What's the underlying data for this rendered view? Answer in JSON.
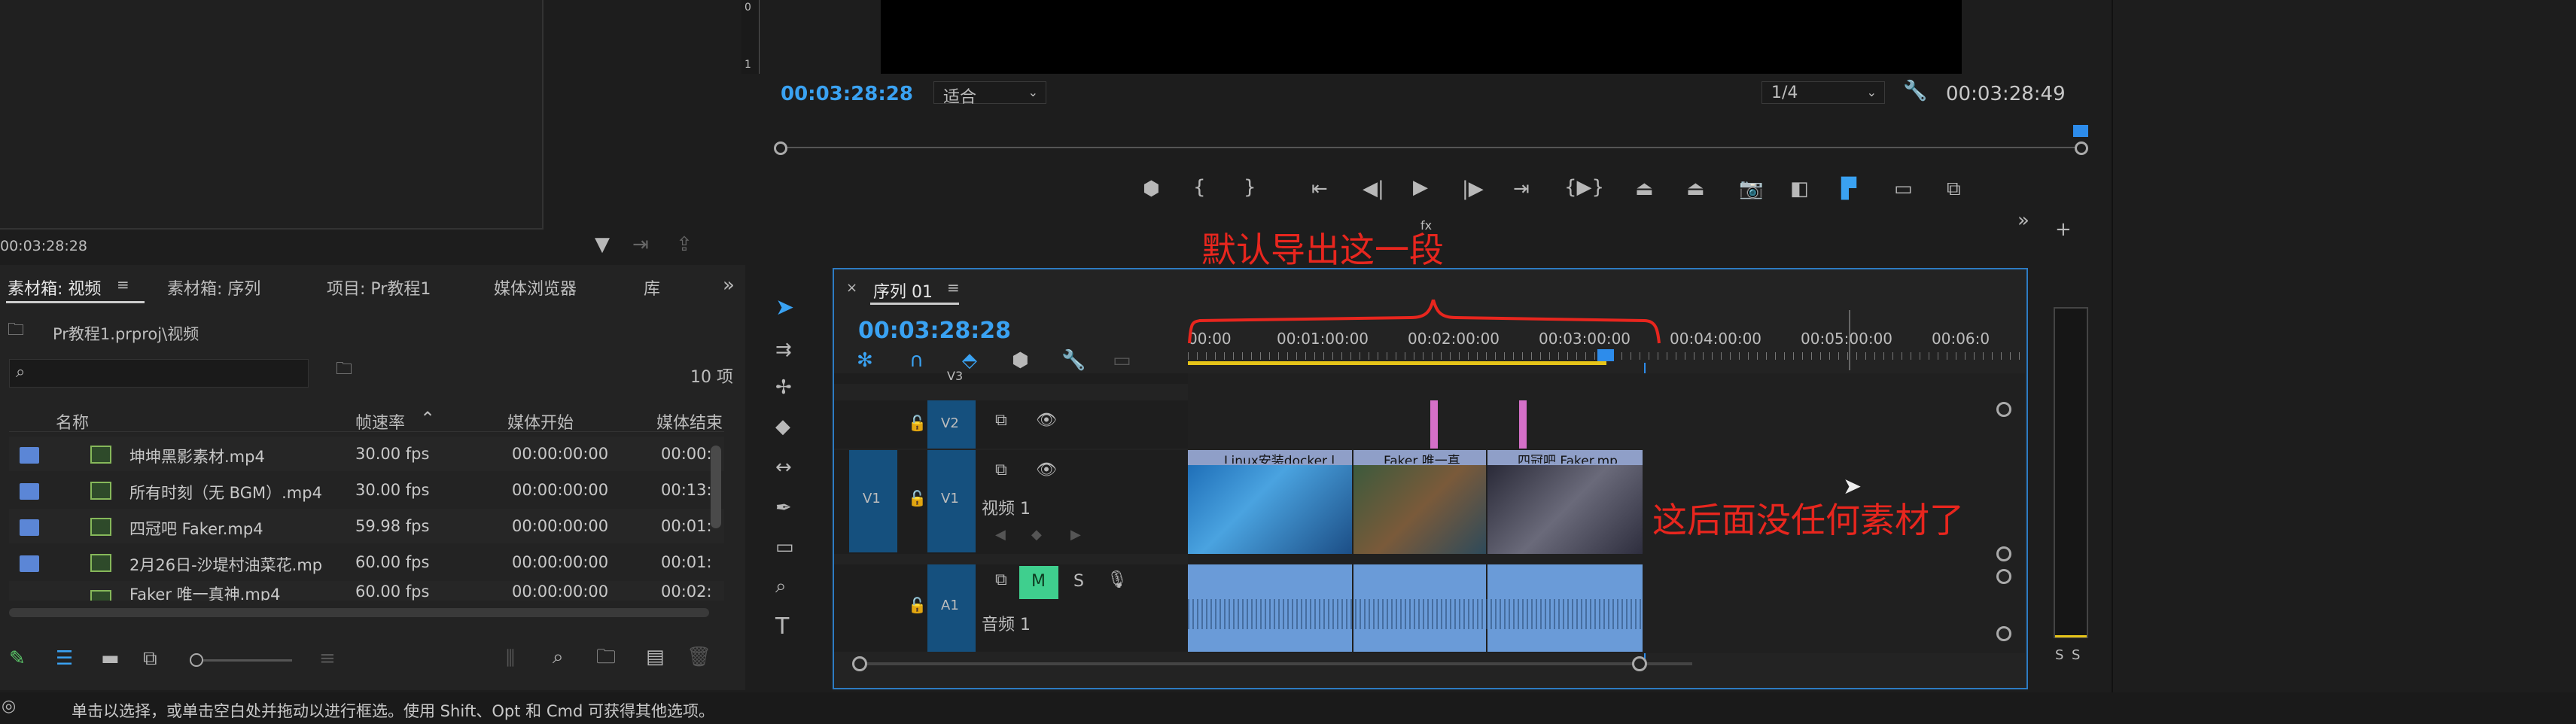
{
  "source_monitor": {
    "timecode": "00:03:28:28",
    "ruler_marks": [
      "0",
      "1"
    ]
  },
  "program_monitor": {
    "current_time": "00:03:28:28",
    "fit_value": "适合",
    "resolution_value": "1/4",
    "duration": "00:03:28:49"
  },
  "project_panel": {
    "tabs": [
      "素材箱: 视频",
      "素材箱: 序列",
      "项目: Pr教程1",
      "媒体浏览器",
      "库"
    ],
    "path": "Pr教程1.prproj\\视频",
    "item_count": "10 项",
    "columns": [
      "名称",
      "帧速率",
      "媒体开始",
      "媒体结束"
    ],
    "rows": [
      {
        "name": "坤坤黑影素材.mp4",
        "fps": "30.00 fps",
        "start": "00:00:00:00",
        "end": "00:00:"
      },
      {
        "name": "所有时刻（无 BGM）.mp4",
        "fps": "30.00 fps",
        "start": "00:00:00:00",
        "end": "00:13:"
      },
      {
        "name": "四冠吧 Faker.mp4",
        "fps": "59.98 fps",
        "start": "00:00:00:00",
        "end": "00:01:"
      },
      {
        "name": "2月26日-沙堤村油菜花.mp",
        "fps": "60.00 fps",
        "start": "00:00:00:00",
        "end": "00:01:"
      },
      {
        "name": "Faker 唯一真神.mp4",
        "fps": "60.00 fps",
        "start": "00:00:00:00",
        "end": "00:02:"
      }
    ]
  },
  "timeline": {
    "sequence_name": "序列 01",
    "timecode": "00:03:28:28",
    "ruler_labels": [
      "00:00",
      "00:01:00:00",
      "00:02:00:00",
      "00:03:00:00",
      "00:04:00:00",
      "00:05:00:00",
      "00:06:0"
    ],
    "tracks": {
      "v3": "V3",
      "v2": "V2",
      "v1_src": "V1",
      "v1": "V1",
      "v1_name": "视频 1",
      "a1": "A1",
      "a1_name": "音频 1",
      "mute": "M",
      "solo": "S"
    },
    "clips": [
      "Linux安装docker l",
      "Faker 唯一真",
      "四冠吧 Faker.mp"
    ],
    "fx": "fx",
    "meter_labels": [
      "S",
      "S"
    ]
  },
  "annotations": {
    "top": "默认导出这一段",
    "right": "这后面没任何素材了"
  },
  "status_bar": {
    "text": "单击以选择，或单击空白处并拖动以进行框选。使用 Shift、Opt 和 Cmd 可获得其他选项。"
  },
  "colors": {
    "accent_blue": "#3aa2f2",
    "annotation_red": "#e8261e",
    "track_blue": "#15507e",
    "audio_clip": "#6a9bd8"
  }
}
